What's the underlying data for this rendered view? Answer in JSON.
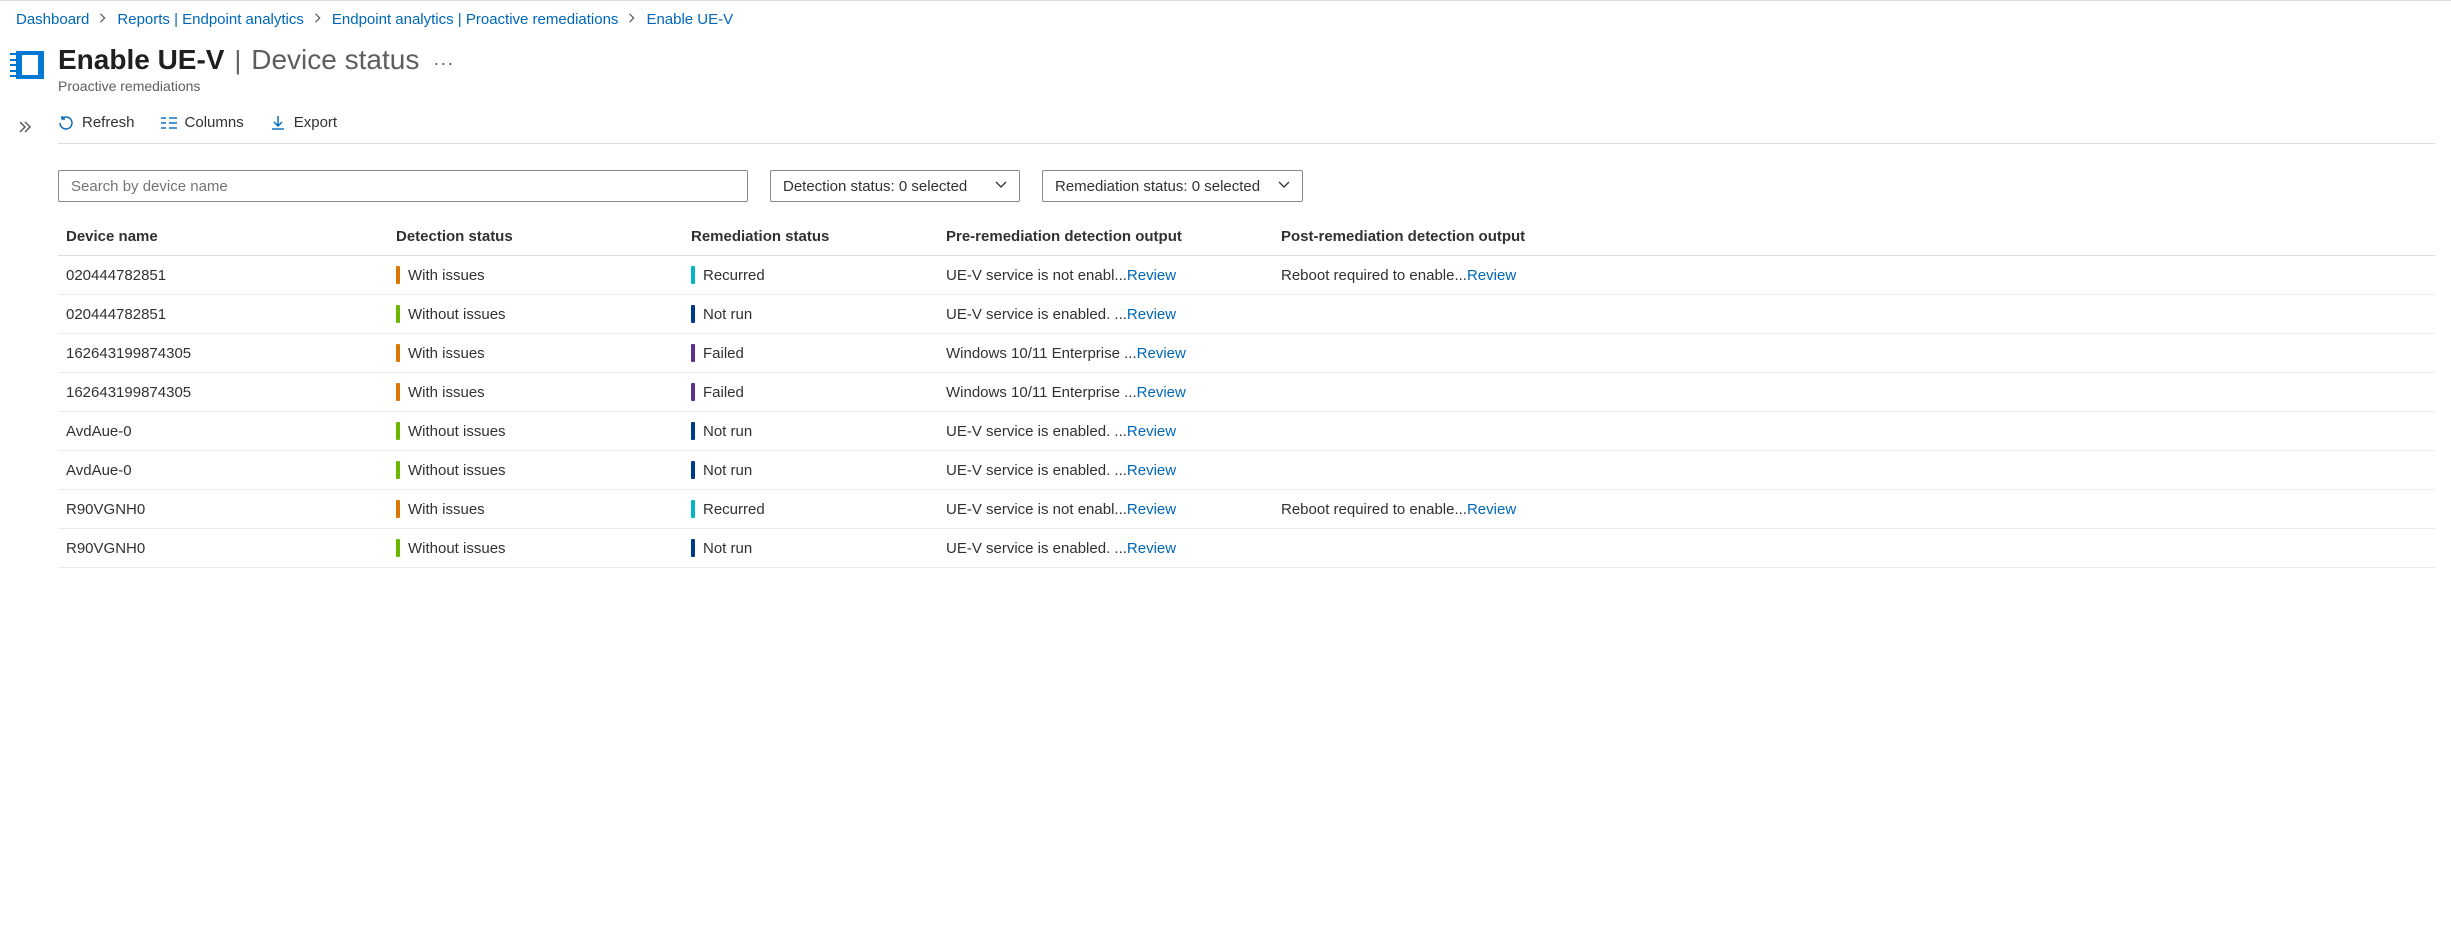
{
  "breadcrumb": [
    {
      "label": "Dashboard"
    },
    {
      "label": "Reports | Endpoint analytics"
    },
    {
      "label": "Endpoint analytics | Proactive remediations"
    },
    {
      "label": "Enable UE-V"
    }
  ],
  "title": {
    "strong": "Enable UE-V",
    "light": "Device status",
    "subtitle": "Proactive remediations"
  },
  "toolbar": {
    "refresh": "Refresh",
    "columns": "Columns",
    "export": "Export"
  },
  "filters": {
    "search_placeholder": "Search by device name",
    "detection_label": "Detection status: 0 selected",
    "remediation_label": "Remediation status: 0 selected"
  },
  "columns": {
    "device": "Device name",
    "detection": "Detection status",
    "remediation": "Remediation status",
    "pre": "Pre-remediation detection output",
    "post": "Post-remediation detection output"
  },
  "status_colors": {
    "With issues": "c-orange",
    "Without issues": "c-green",
    "Recurred": "c-teal",
    "Not run": "c-navy",
    "Failed": "c-purple"
  },
  "review_label": "Review",
  "rows": [
    {
      "device": "020444782851",
      "detection": "With issues",
      "remediation": "Recurred",
      "pre": "UE-V service is not enabl...",
      "post": "Reboot required to enable..."
    },
    {
      "device": "020444782851",
      "detection": "Without issues",
      "remediation": "Not run",
      "pre": "UE-V service is enabled. ...",
      "post": ""
    },
    {
      "device": "162643199874305",
      "detection": "With issues",
      "remediation": "Failed",
      "pre": "Windows 10/11 Enterprise ...",
      "post": ""
    },
    {
      "device": "162643199874305",
      "detection": "With issues",
      "remediation": "Failed",
      "pre": "Windows 10/11 Enterprise ...",
      "post": ""
    },
    {
      "device": "AvdAue-0",
      "detection": "Without issues",
      "remediation": "Not run",
      "pre": "UE-V service is enabled. ...",
      "post": ""
    },
    {
      "device": "AvdAue-0",
      "detection": "Without issues",
      "remediation": "Not run",
      "pre": "UE-V service is enabled. ...",
      "post": ""
    },
    {
      "device": "R90VGNH0",
      "detection": "With issues",
      "remediation": "Recurred",
      "pre": "UE-V service is not enabl...",
      "post": "Reboot required to enable..."
    },
    {
      "device": "R90VGNH0",
      "detection": "Without issues",
      "remediation": "Not run",
      "pre": "UE-V service is enabled. ...",
      "post": ""
    }
  ]
}
